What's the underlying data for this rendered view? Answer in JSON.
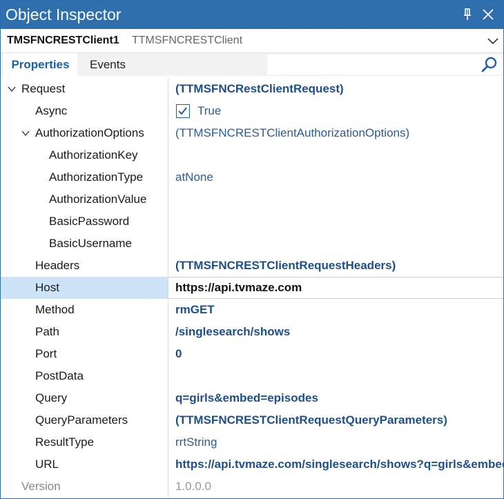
{
  "window": {
    "title": "Object Inspector"
  },
  "selector": {
    "object_name": "TMSFNCRESTClient1",
    "object_class": "TTMSFNCRESTClient"
  },
  "tabs": [
    {
      "label": "Properties",
      "active": true
    },
    {
      "label": "Events",
      "active": false
    }
  ],
  "search": {
    "placeholder": ""
  },
  "properties": [
    {
      "name": "Request",
      "value": "(TTMSFNCRestClientRequest)",
      "expanded": true,
      "level": 0
    },
    {
      "name": "Async",
      "value": "True",
      "checked": true,
      "level": 1
    },
    {
      "name": "AuthorizationOptions",
      "value": "(TTMSFNCRESTClientAuthorizationOptions)",
      "expanded": true,
      "level": 1
    },
    {
      "name": "AuthorizationKey",
      "value": "",
      "level": 2
    },
    {
      "name": "AuthorizationType",
      "value": "atNone",
      "level": 2
    },
    {
      "name": "AuthorizationValue",
      "value": "",
      "level": 2
    },
    {
      "name": "BasicPassword",
      "value": "",
      "level": 2
    },
    {
      "name": "BasicUsername",
      "value": "",
      "level": 2
    },
    {
      "name": "Headers",
      "value": "(TTMSFNCRESTClientRequestHeaders)",
      "level": 1
    },
    {
      "name": "Host",
      "value": "https://api.tvmaze.com",
      "level": 1,
      "selected": true
    },
    {
      "name": "Method",
      "value": "rmGET",
      "level": 1
    },
    {
      "name": "Path",
      "value": "/singlesearch/shows",
      "level": 1
    },
    {
      "name": "Port",
      "value": "0",
      "level": 1
    },
    {
      "name": "PostData",
      "value": "",
      "level": 1
    },
    {
      "name": "Query",
      "value": "q=girls&embed=episodes",
      "level": 1
    },
    {
      "name": "QueryParameters",
      "value": "(TTMSFNCRESTClientRequestQueryParameters)",
      "level": 1
    },
    {
      "name": "ResultType",
      "value": "rrtString",
      "level": 1
    },
    {
      "name": "URL",
      "value": "https://api.tvmaze.com/singlesearch/shows?q=girls&embed=episodes",
      "level": 1
    },
    {
      "name": "Version",
      "value": "1.0.0.0",
      "level": 0,
      "muted": true
    }
  ],
  "colors": {
    "titlebar": "#2f6fae",
    "accent": "#1f5fa6",
    "selected_row": "#cde3f7"
  }
}
